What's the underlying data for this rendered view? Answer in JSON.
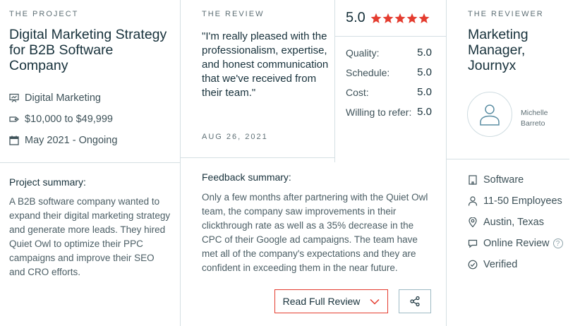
{
  "project": {
    "eyebrow": "THE PROJECT",
    "title": "Digital Marketing Strategy for B2B Software Company",
    "service": "Digital Marketing",
    "budget": "$10,000 to $49,999",
    "timeline": "May 2021 - Ongoing",
    "summary_label": "Project summary:",
    "summary": "A B2B software company wanted to expand their digital marketing strategy and generate more leads. They hired Quiet Owl to optimize their PPC campaigns and improve their SEO and CRO efforts."
  },
  "review": {
    "eyebrow": "THE REVIEW",
    "quote": "\"I'm really pleased with the professionalism, expertise, and honest communication that we've received from their team.\"",
    "date": "AUG 26, 2021",
    "feedback_label": "Feedback summary:",
    "feedback": "Only a few months after partnering with the Quiet Owl team, the company saw improvements in their clickthrough rate as well as a 35% decrease in the CPC of their Google ad campaigns. The team have met all of the company's expectations and they are confident in exceeding them in the near future.",
    "overall": "5.0",
    "stars": 5,
    "ratings": [
      {
        "label": "Quality:",
        "value": "5.0"
      },
      {
        "label": "Schedule:",
        "value": "5.0"
      },
      {
        "label": "Cost:",
        "value": "5.0"
      },
      {
        "label": "Willing to refer:",
        "value": "5.0"
      }
    ],
    "read_button": "Read Full Review"
  },
  "reviewer": {
    "eyebrow": "THE REVIEWER",
    "title": "Marketing Manager, Journyx",
    "name": "Michelle Barreto",
    "industry": "Software",
    "size": "11-50 Employees",
    "location": "Austin, Texas",
    "review_type": "Online Review",
    "help": "?",
    "status": "Verified"
  },
  "colors": {
    "accent_red": "#e43c2f",
    "text_dark": "#17313b",
    "divider": "#d5dfe3"
  }
}
